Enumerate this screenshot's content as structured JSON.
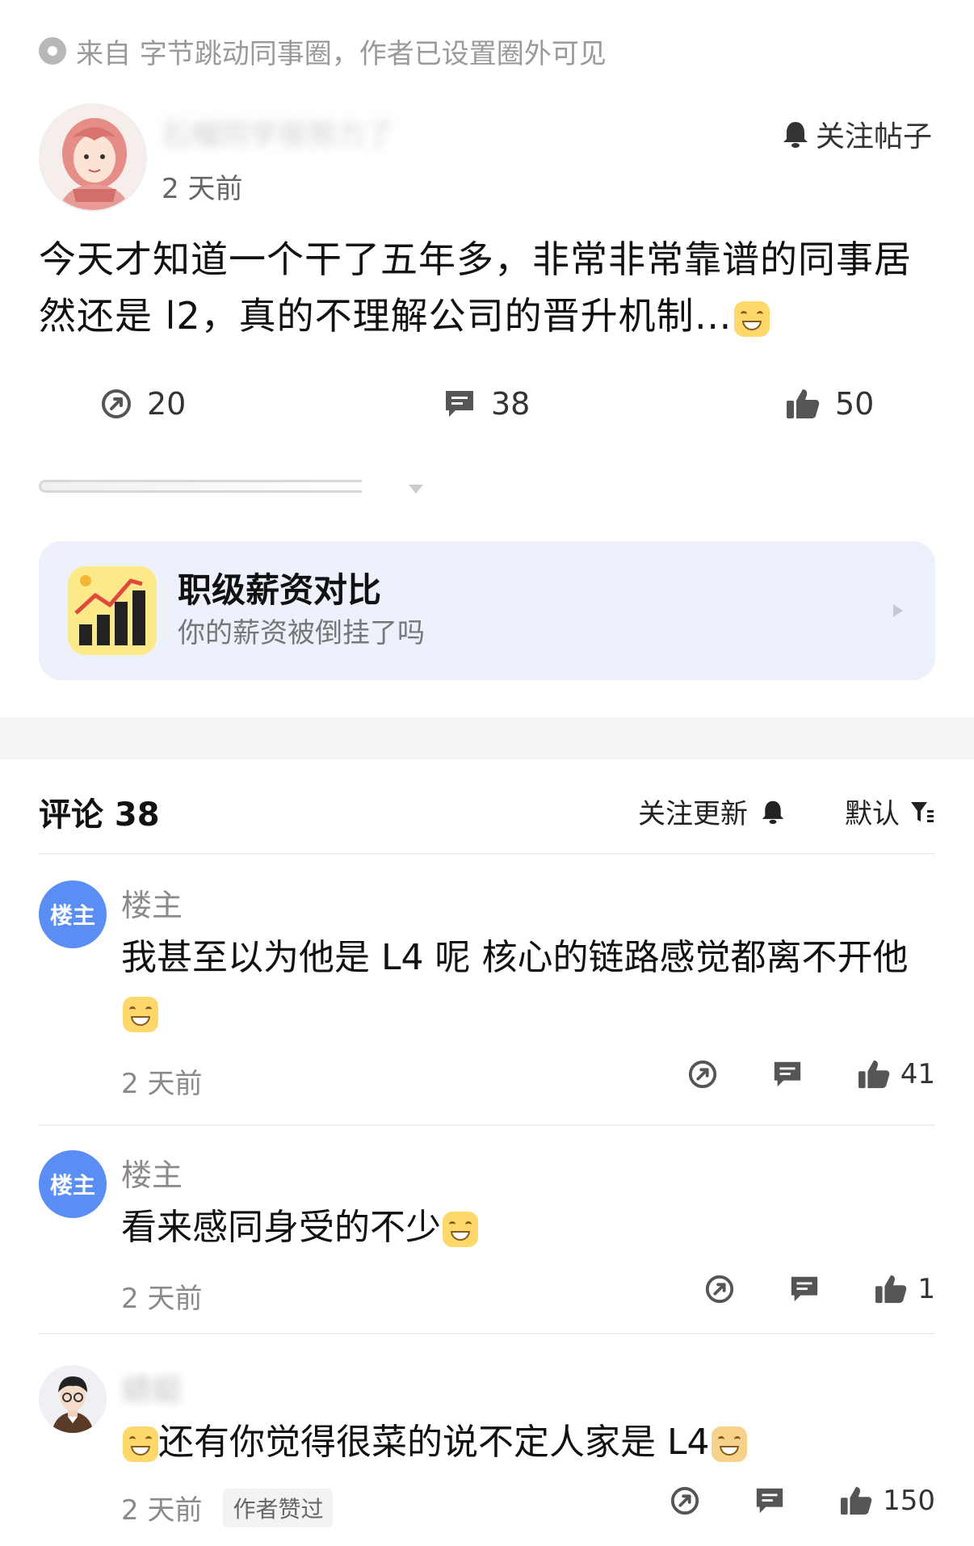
{
  "source": {
    "text": "来自 字节跳动同事圈，作者已设置圈外可见"
  },
  "post": {
    "author_name": "石榴同学很努力了",
    "time": "2 天前",
    "follow_label": "关注帖子",
    "body": "今天才知道一个干了五年多，非常非常靠谱的同事居然还是 l2，真的不理解公司的晋升机制…",
    "stats": {
      "shares": "20",
      "comments": "38",
      "likes": "50"
    }
  },
  "salary_card": {
    "title": "职级薪资对比",
    "subtitle": "你的薪资被倒挂了吗"
  },
  "comments_header": {
    "title": "评论 38",
    "follow_updates": "关注更新",
    "sort": "默认"
  },
  "comments": [
    {
      "avatar_label": "楼主",
      "name": "楼主",
      "text": "我甚至以为他是 L4 呢 核心的链路感觉都离不开他",
      "time": "2 天前",
      "likes": "41"
    },
    {
      "avatar_label": "楼主",
      "name": "楼主",
      "text": "看来感同身受的不少",
      "time": "2 天前",
      "likes": "1"
    },
    {
      "name": "蜻蜓",
      "text": "还有你觉得很菜的说不定人家是 L4",
      "time": "2 天前",
      "badge": "作者赞过",
      "likes": "150"
    }
  ]
}
